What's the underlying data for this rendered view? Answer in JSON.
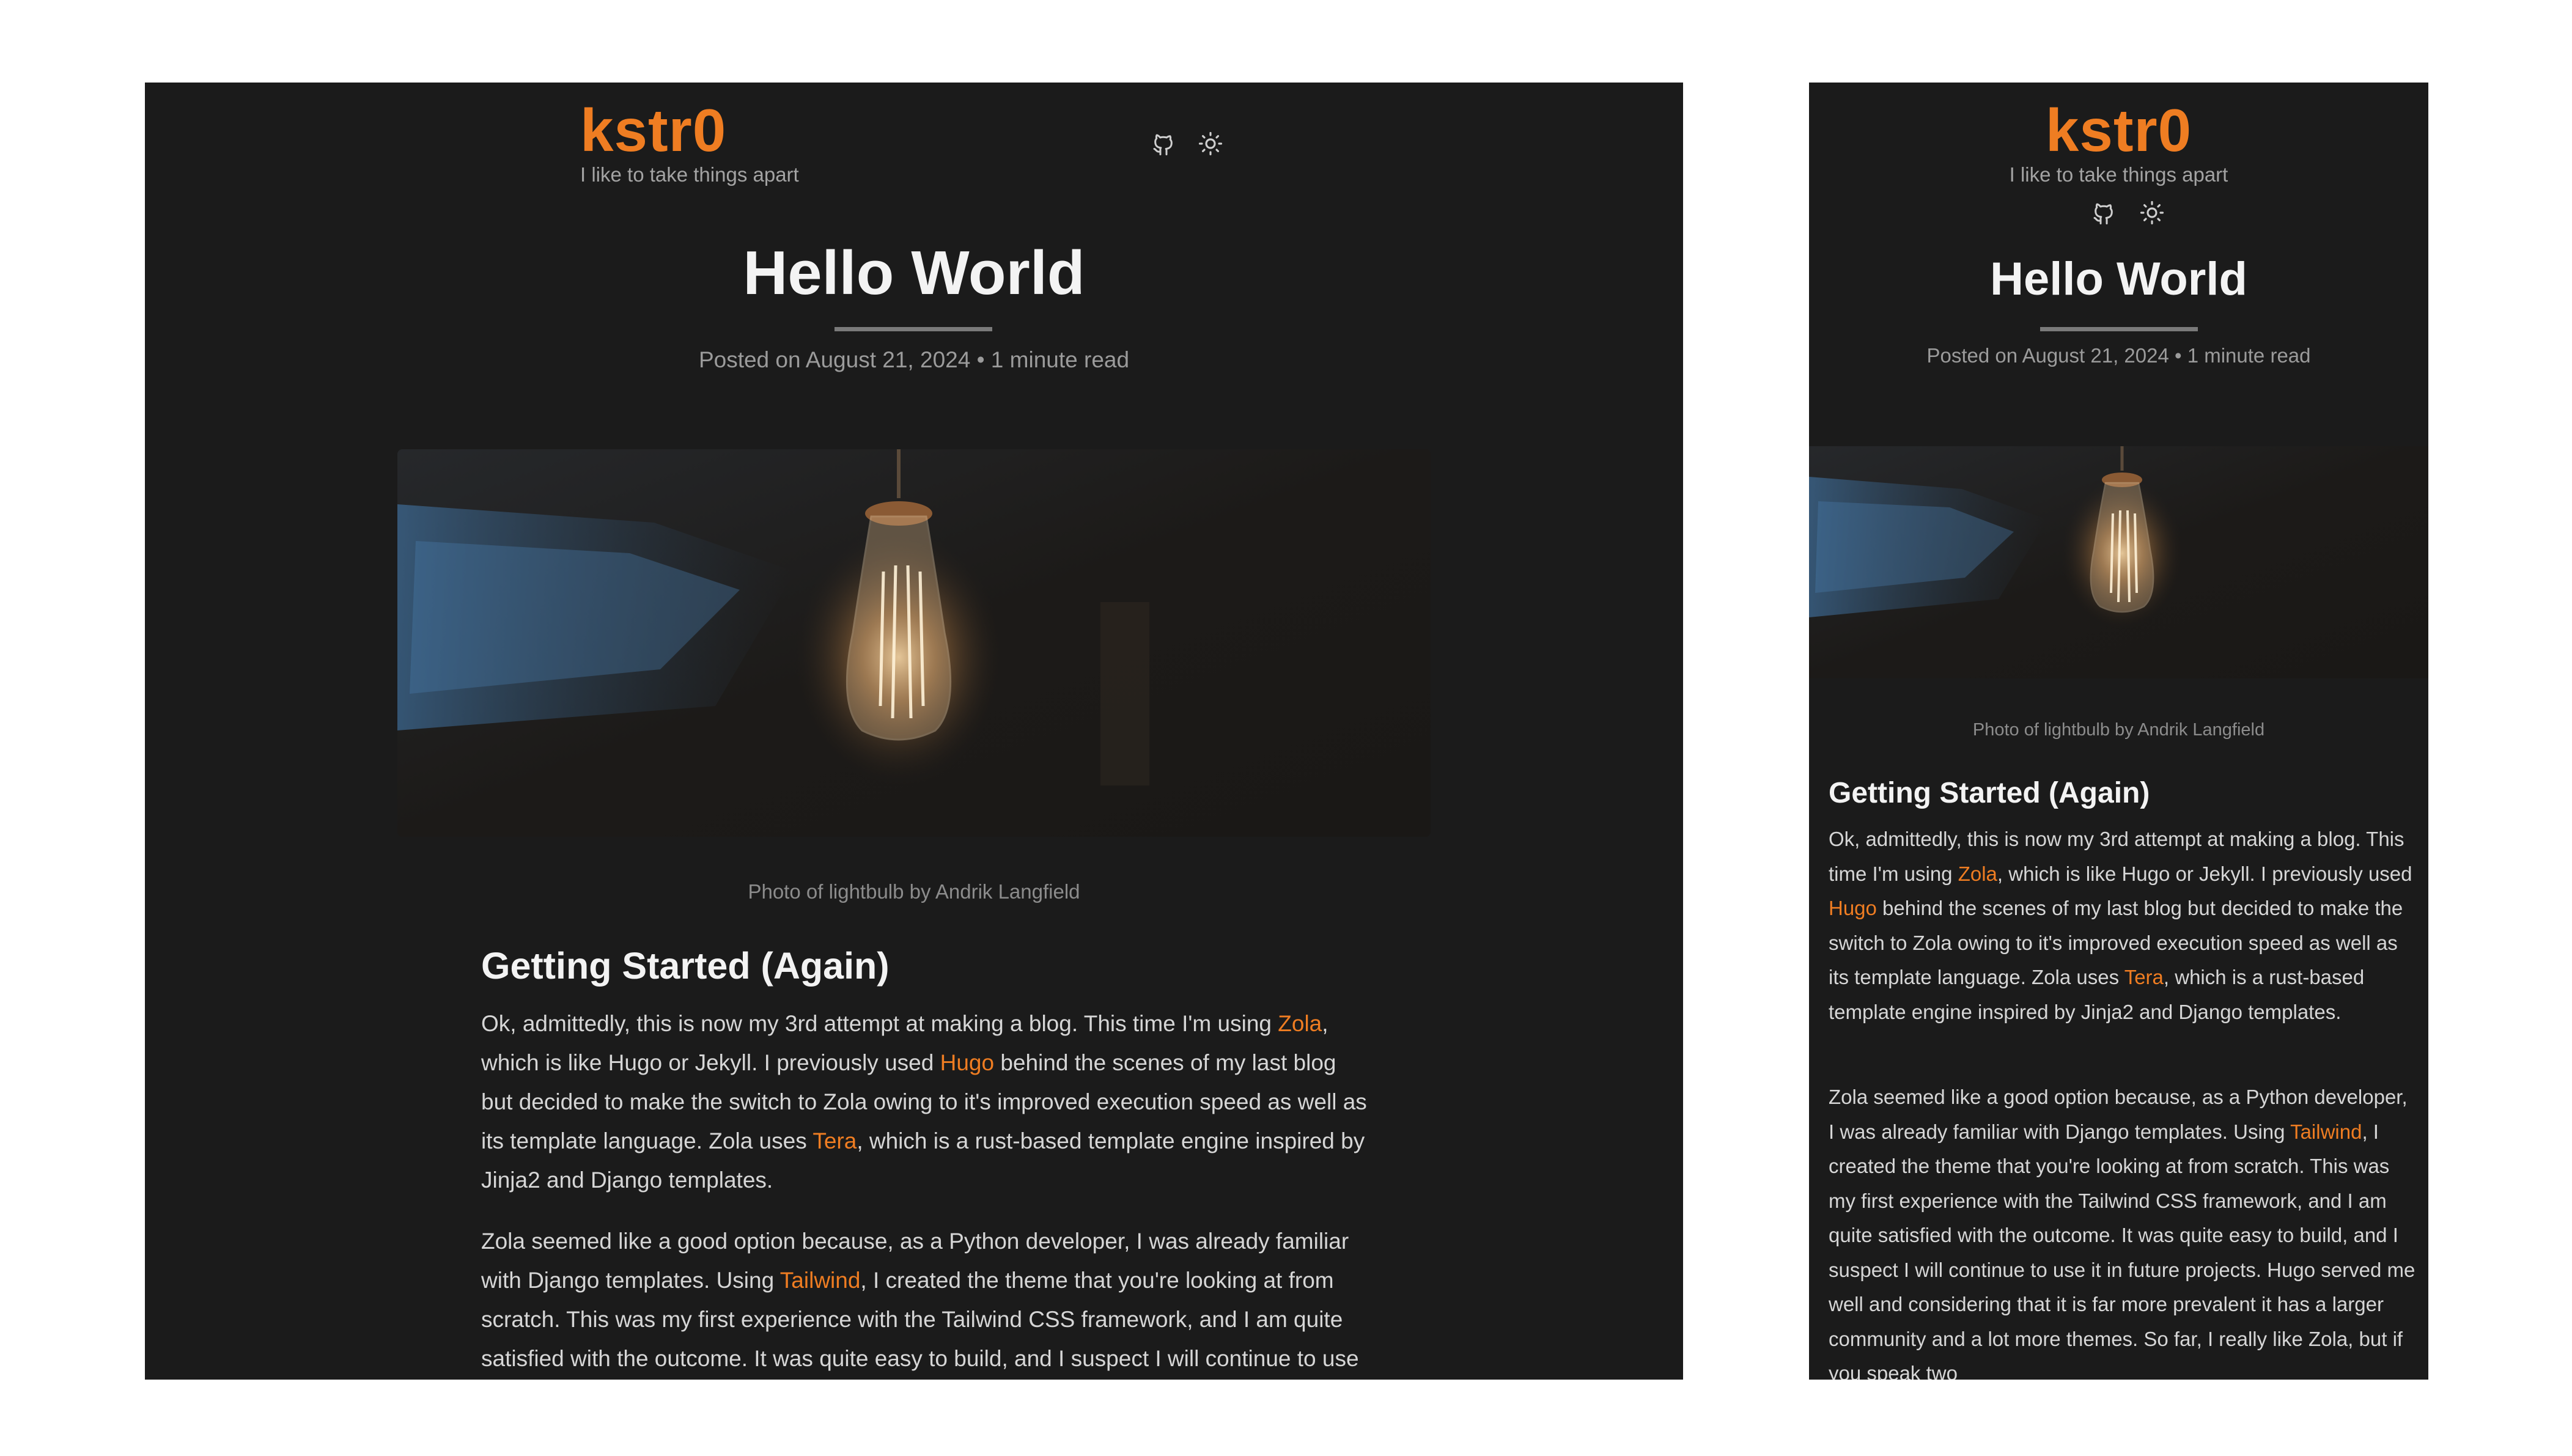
{
  "site": {
    "brand": "kstr0",
    "tagline": "I like to take things apart"
  },
  "header_icons": [
    "github-icon",
    "sun-icon"
  ],
  "post": {
    "title": "Hello World",
    "meta": "Posted on August 21, 2024 • 1 minute read",
    "image_caption": "Photo of lightbulb by Andrik Langfield",
    "section_heading": "Getting Started (Again)",
    "para1": {
      "t1": "Ok, admittedly, this is now my 3rd attempt at making a blog. This time I'm using ",
      "link_zola": "Zola",
      "t2": ", which is like Hugo or Jekyll. I previously used ",
      "link_hugo": "Hugo",
      "t3": " behind the scenes of my last blog but decided to make the switch to Zola owing to it's improved execution speed as well as its template language. Zola uses ",
      "link_tera": "Tera",
      "t4": ", which is a rust-based template engine inspired by Jinja2 and Django templates."
    },
    "para2": {
      "t1": "Zola seemed like a good option because, as a Python developer, I was already familiar with Django templates. Using ",
      "link_tailwind": "Tailwind",
      "t2": ", I created the theme that you're looking at from scratch. This was my first experience with the Tailwind CSS framework, and I am quite satisfied with the outcome. It was quite easy to build, and I suspect I will continue to use it in future projects. Hugo served me well and considering that it is far more prevalent it has a larger community and a lot more themes. So far, I really like Zola, but if you speak two"
    }
  },
  "colors": {
    "background": "#1b1b1b",
    "accent": "#ef7d22",
    "text": "#d6d6d6",
    "heading": "#f3f3f3",
    "muted": "#9b9b9b"
  }
}
